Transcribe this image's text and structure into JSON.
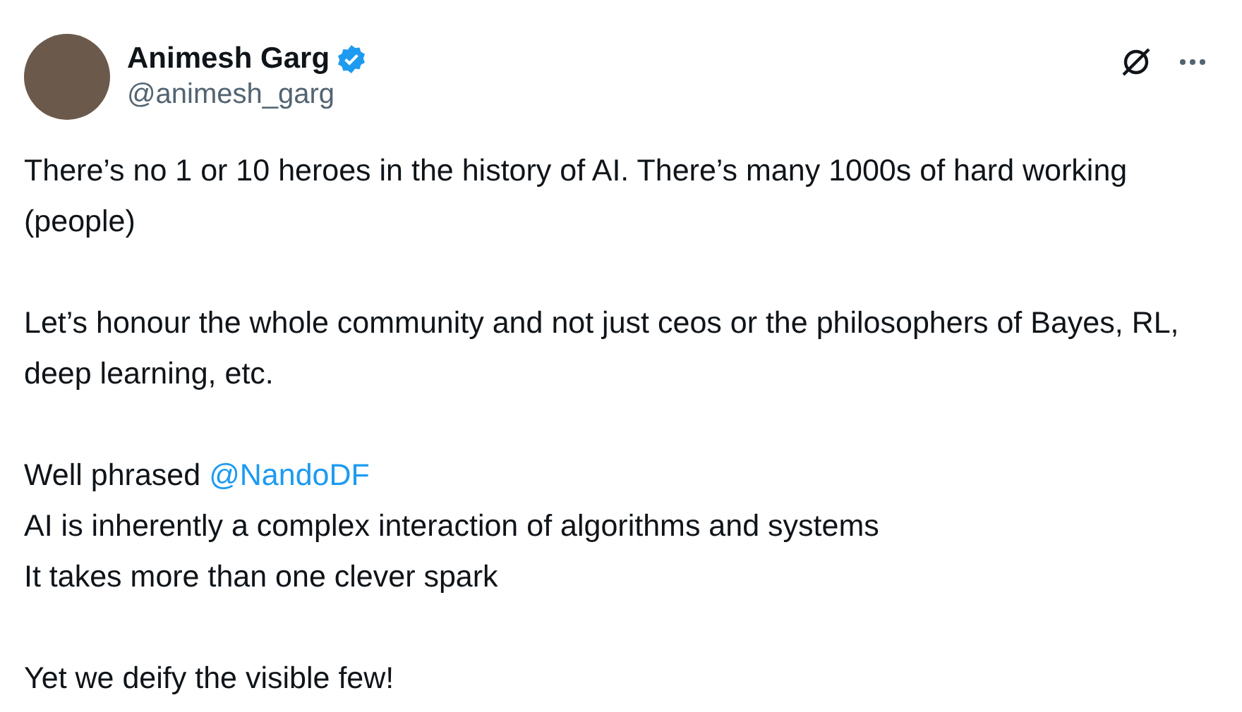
{
  "author": {
    "name": "Animesh Garg",
    "verified": true,
    "handle": "@animesh_garg"
  },
  "paragraphs": [
    {
      "lines": [
        [
          {
            "kind": "text",
            "text": "There’s no 1 or 10 heroes in the history of AI. There’s many 1000s of hard working (people)"
          }
        ]
      ]
    },
    {
      "lines": [
        [
          {
            "kind": "text",
            "text": "Let’s honour the whole community and not just ceos or the philosophers of Bayes, RL, deep learning, etc."
          }
        ]
      ]
    },
    {
      "lines": [
        [
          {
            "kind": "text",
            "text": "Well phrased"
          },
          {
            "kind": "mention",
            "text": "@NandoDF"
          }
        ],
        [
          {
            "kind": "text",
            "text": "AI is inherently a complex interaction of algorithms and systems"
          }
        ],
        [
          {
            "kind": "text",
            "text": "It takes more than one clever spark"
          }
        ]
      ]
    },
    {
      "lines": [
        [
          {
            "kind": "text",
            "text": "Yet we deify the visible few!"
          }
        ]
      ]
    }
  ]
}
